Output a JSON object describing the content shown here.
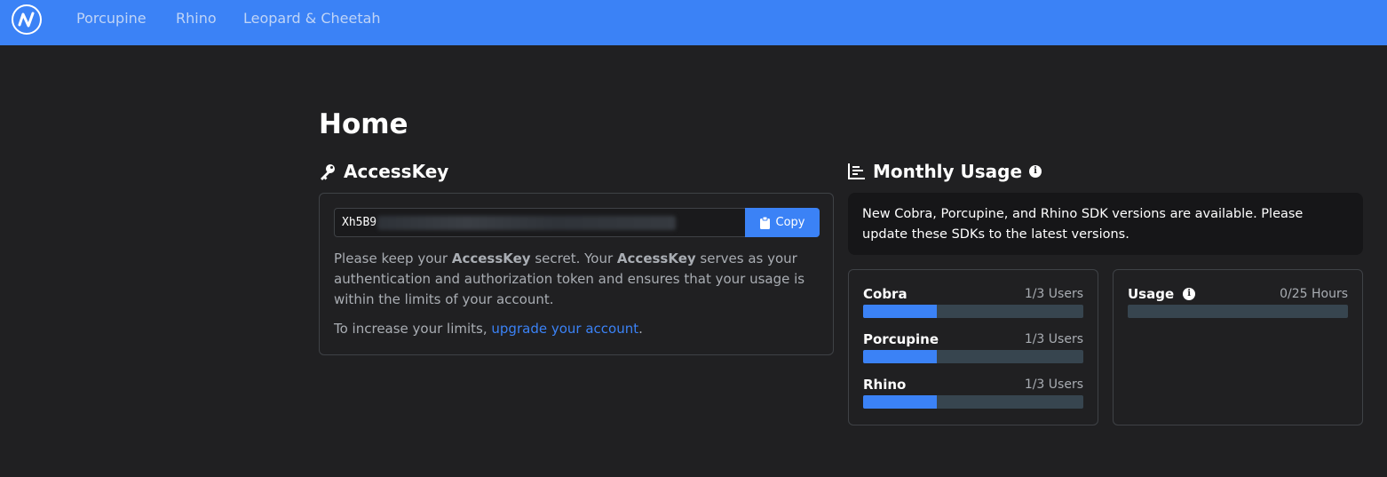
{
  "nav": {
    "links": [
      "Porcupine",
      "Rhino",
      "Leopard & Cheetah"
    ]
  },
  "page": {
    "title": "Home"
  },
  "access_key": {
    "title": "AccessKey",
    "key_visible_prefix": "Xh5B9",
    "copy_label": "Copy",
    "description_parts": [
      "Please keep your ",
      "AccessKey",
      " secret. Your ",
      "AccessKey",
      " serves as your authentication and authorization token and ensures that your usage is within the limits of your account."
    ],
    "limits_text": "To increase your limits, ",
    "upgrade_link": "upgrade your account",
    "limits_suffix": "."
  },
  "monthly_usage": {
    "title": "Monthly Usage",
    "notice": "New Cobra, Porcupine, and Rhino SDK versions are available. Please update these SDKs to the latest versions.",
    "products": [
      {
        "name": "Cobra",
        "count": "1/3 Users",
        "fraction": 0.3333
      },
      {
        "name": "Porcupine",
        "count": "1/3 Users",
        "fraction": 0.3333
      },
      {
        "name": "Rhino",
        "count": "1/3 Users",
        "fraction": 0.3333
      }
    ],
    "usage": {
      "label": "Usage",
      "count": "0/25 Hours",
      "fraction": 0
    }
  },
  "colors": {
    "accent": "#3b82f6",
    "background": "#202022",
    "bar_track": "#37454f"
  }
}
